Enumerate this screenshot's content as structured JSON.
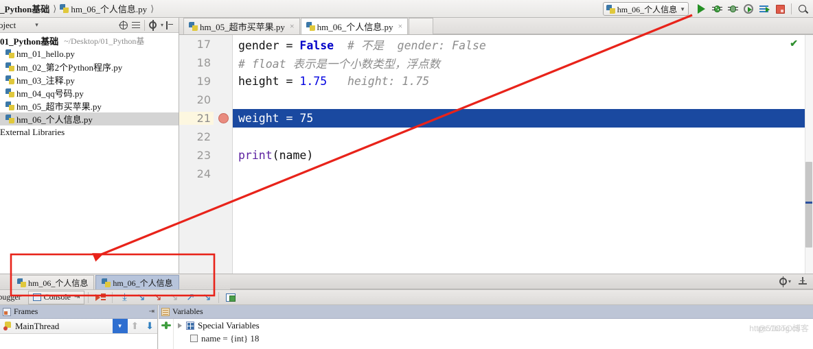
{
  "breadcrumb": {
    "project": "_Python基础",
    "file": "hm_06_个人信息.py",
    "sep": "❯"
  },
  "toolbar": {
    "run_config": "hm_06_个人信息",
    "run_config_caret": "▼",
    "buttons": [
      {
        "name": "run-button",
        "label": "Run"
      },
      {
        "name": "debug-button",
        "label": "Debug"
      },
      {
        "name": "run-with-profiler-button",
        "label": "Profile"
      },
      {
        "name": "run-with-coverage-button",
        "label": "Coverage"
      },
      {
        "name": "run-flow-button",
        "label": "Flow"
      },
      {
        "name": "stop-button",
        "label": "Stop"
      },
      {
        "name": "search-everywhere-button",
        "label": "Search"
      }
    ]
  },
  "project_panel": {
    "title": "oject",
    "caret": "▾",
    "header_icons": [
      "collapse-all-icon",
      "expand-all-icon",
      "settings-icon",
      "hide-icon"
    ],
    "root": {
      "label": "01_Python基础",
      "path": "~/Desktop/01_Python基"
    },
    "files": [
      "hm_01_hello.py",
      "hm_02_第2个Python程序.py",
      "hm_03_注释.py",
      "hm_04_qq号码.py",
      "hm_05_超市买苹果.py",
      "hm_06_个人信息.py"
    ],
    "selected_file": "hm_06_个人信息.py",
    "external_libraries": "External Libraries"
  },
  "editor": {
    "tabs": [
      {
        "label": "hm_05_超市买苹果.py",
        "active": false,
        "close": "×"
      },
      {
        "label": "hm_06_个人信息.py",
        "active": true,
        "close": "×"
      }
    ],
    "inspection_ok": "✔",
    "lines": [
      {
        "number": "17",
        "breakpoint": false,
        "current": false,
        "tokens": [
          {
            "text": "gender = ",
            "style": "plain"
          },
          {
            "text": "False",
            "style": "kw"
          },
          {
            "text": "  # 不是  gender: False",
            "style": "comment"
          }
        ]
      },
      {
        "number": "18",
        "breakpoint": false,
        "current": false,
        "tokens": [
          {
            "text": "# float 表示是一个小数类型，浮点数",
            "style": "comment"
          }
        ]
      },
      {
        "number": "19",
        "breakpoint": false,
        "current": false,
        "tokens": [
          {
            "text": "height = ",
            "style": "plain"
          },
          {
            "text": "1.75",
            "style": "num"
          },
          {
            "text": "   height: 1.75",
            "style": "comment"
          }
        ]
      },
      {
        "number": "20",
        "breakpoint": false,
        "current": false,
        "tokens": []
      },
      {
        "number": "21",
        "breakpoint": true,
        "current": true,
        "tokens": [
          {
            "text": "weight = 75",
            "style": "plain"
          }
        ]
      },
      {
        "number": "22",
        "breakpoint": false,
        "current": false,
        "tokens": []
      },
      {
        "number": "23",
        "breakpoint": false,
        "current": false,
        "tokens": [
          {
            "text": "print",
            "style": "fn"
          },
          {
            "text": "(name)",
            "style": "plain"
          }
        ]
      },
      {
        "number": "24",
        "breakpoint": false,
        "current": false,
        "tokens": []
      }
    ]
  },
  "debug_panel": {
    "run_tabs": [
      {
        "label": "hm_06_个人信息",
        "active": false
      },
      {
        "label": "hm_06_个人信息",
        "active": true
      }
    ],
    "debugger_label": "ebugger",
    "console_label": "Console",
    "console_pin": "⇥",
    "buttons": [
      {
        "name": "rerun-button",
        "label": "Rerun"
      },
      {
        "name": "step-over-button",
        "label": "Step Over"
      },
      {
        "name": "step-into-button",
        "label": "Step Into"
      },
      {
        "name": "force-step-into-button",
        "label": "Force Step Into"
      },
      {
        "name": "step-out-button",
        "label": "Step Out"
      },
      {
        "name": "run-to-cursor-button",
        "label": "Run to Cursor"
      },
      {
        "name": "drop-frame-button",
        "label": "Drop Frame"
      },
      {
        "name": "evaluate-expression-button",
        "label": "Evaluate Expression"
      }
    ]
  },
  "frames": {
    "title": "Frames",
    "pin": "⇥",
    "thread": "MainThread",
    "dropdown_caret": "▼",
    "up": "⬆",
    "down": "⬇"
  },
  "variables": {
    "title": "Variables",
    "rows": [
      {
        "expander": "▶",
        "label": "Special Variables"
      },
      {
        "expander": "",
        "label": "name = {int} 18"
      }
    ]
  },
  "status_bar": {
    "gear": "settings-icon",
    "minimize": "hide-icon"
  },
  "watermark": {
    "url": "https://blog.cs",
    "brand": "@51CTO博客"
  },
  "annotation": {
    "arrow_color": "#e8231a",
    "rect_color": "#e8231a"
  }
}
